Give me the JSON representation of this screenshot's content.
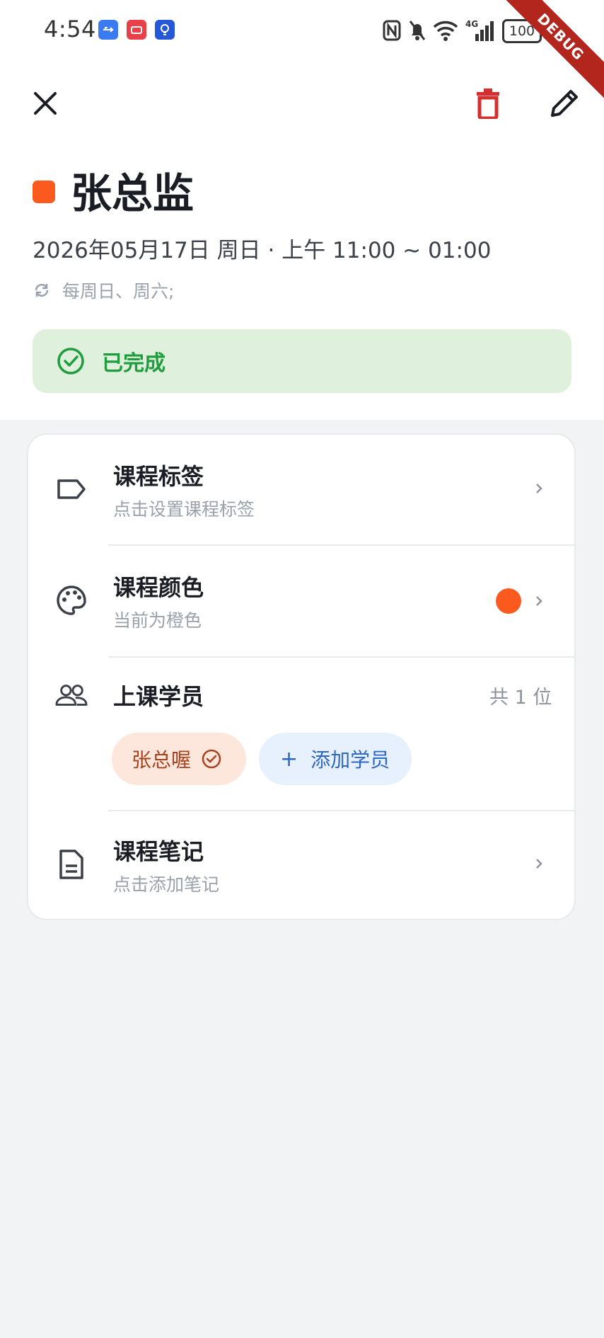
{
  "status_bar": {
    "time": "4:54",
    "battery": "100",
    "debug_banner": "DEBUG"
  },
  "toolbar": {
    "close_icon": "close-icon",
    "delete_icon": "trash-icon",
    "edit_icon": "pencil-icon",
    "delete_color": "#d32f2f"
  },
  "course": {
    "title": "张总监",
    "color_hex": "#fa5a1e",
    "datetime": "2026年05月17日 周日 · 上午 11:00 ~ 01:00",
    "repeat": "每周日、周六;",
    "status_label": "已完成",
    "status_color": "#1f9d3e"
  },
  "settings": {
    "tags": {
      "title": "课程标签",
      "subtitle": "点击设置课程标签"
    },
    "color": {
      "title": "课程颜色",
      "subtitle": "当前为橙色"
    },
    "students": {
      "title": "上课学员",
      "count": "共 1 位",
      "items": [
        {
          "name": "张总喔"
        }
      ],
      "add_label": "添加学员",
      "add_symbol": "+"
    },
    "notes": {
      "title": "课程笔记",
      "subtitle": "点击添加笔记"
    }
  }
}
